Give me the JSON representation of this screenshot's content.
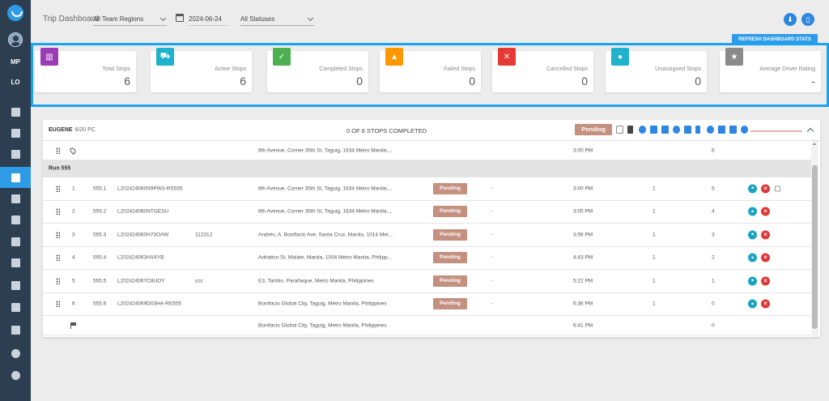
{
  "header": {
    "title": "Trip Dashboard",
    "region_select": "All Team Regions",
    "date": "2024-06-24",
    "status_select": "All Statuses"
  },
  "sidebar": {
    "initials_1": "MP",
    "initials_2": "LO"
  },
  "refresh_button": "REFRESH DASHBOARD STATS",
  "colors": {
    "accent": "#2e9be6",
    "sidebar": "#2c3e50",
    "pending": "#c49080"
  },
  "stats": [
    {
      "label": "Total Stops",
      "value": "6",
      "icon": "chart-icon",
      "color": "#9b3bb6"
    },
    {
      "label": "Active Stops",
      "value": "6",
      "icon": "truck-icon",
      "color": "#1fb2cc"
    },
    {
      "label": "Completed Stops",
      "value": "0",
      "icon": "check-icon",
      "color": "#4caf50"
    },
    {
      "label": "Failed Stops",
      "value": "0",
      "icon": "warning-icon",
      "color": "#ff9800"
    },
    {
      "label": "Cancelled Stops",
      "value": "0",
      "icon": "cancel-icon",
      "color": "#e53935"
    },
    {
      "label": "Unassigned Stops",
      "value": "0",
      "icon": "person-icon",
      "color": "#1fb2cc"
    },
    {
      "label": "Average Driver Rating",
      "value": "-",
      "icon": "star-icon",
      "color": "#8a8a8a"
    }
  ],
  "run": {
    "driver": "EUGENE",
    "driver_sub": "6/20 PC",
    "progress": "0 OF 6 STOPS COMPLETED",
    "status": "Pending",
    "start": {
      "address": "8th Avenue, Corner 35th St, Taguig, 1634 Metro Manila,...",
      "time": "3:00 PM",
      "count": "6"
    },
    "group_label": "Run 555",
    "stops": [
      {
        "num": "1",
        "code": "555.1",
        "order": "L202424060N9PW3-RS555",
        "ref": "",
        "address": "8th Avenue, Corner 35th St, Taguig, 1634 Metro Manila,...",
        "status": "Pending",
        "dash": "-",
        "time": "3:00 PM",
        "qty": "1",
        "remaining": "5"
      },
      {
        "num": "2",
        "code": "555.2",
        "order": "L202424060NTGESU",
        "ref": "",
        "address": "8th Avenue, Corner 35th St, Taguig, 1634 Metro Manila,...",
        "status": "Pending",
        "dash": "-",
        "time": "3:05 PM",
        "qty": "1",
        "remaining": "4"
      },
      {
        "num": "3",
        "code": "555.3",
        "order": "L202424060H73OAW",
        "ref": "112312",
        "address": "Andrés, A. Bonifacio Ave, Santa Cruz, Manila, 1014 Met...",
        "status": "Pending",
        "dash": "-",
        "time": "3:56 PM",
        "qty": "1",
        "remaining": "3"
      },
      {
        "num": "4",
        "code": "555.4",
        "order": "L202424063HV4YB",
        "ref": "",
        "address": "Adriatico St, Malate, Manila, 1004 Metro Manila, Philipp...",
        "status": "Pending",
        "dash": "-",
        "time": "4:43 PM",
        "qty": "1",
        "remaining": "2"
      },
      {
        "num": "5",
        "code": "555.5",
        "order": "L202424067C8UOY",
        "ref": "ccc",
        "address": "E3, Tambo, Parañaque, Metro Manila, Philippines",
        "status": "Pending",
        "dash": "-",
        "time": "5:22 PM",
        "qty": "1",
        "remaining": "1"
      },
      {
        "num": "6",
        "code": "555.6",
        "order": "L202424069D03HA-RE555",
        "ref": "",
        "address": "Bonifacio Global City, Taguig, Metro Manila, Philippines",
        "status": "Pending",
        "dash": "-",
        "time": "6:36 PM",
        "qty": "1",
        "remaining": "0"
      }
    ],
    "end": {
      "address": "Bonifacio Global City, Taguig, Metro Manila, Philippines",
      "time": "6:41 PM",
      "count": "0"
    }
  }
}
